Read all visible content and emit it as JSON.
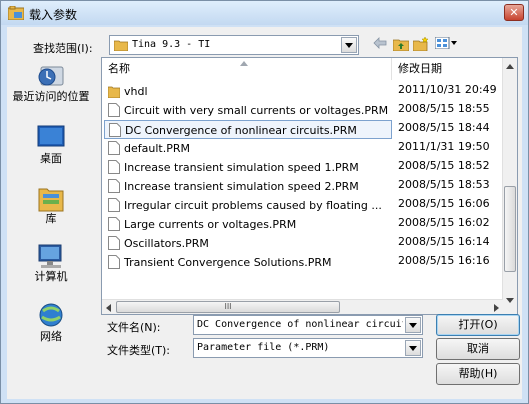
{
  "window": {
    "title": "载入参数",
    "close_label": "✕"
  },
  "toolbar": {
    "look_in_label": "查找范围(I):",
    "look_in_value": "Tina 9.3 - TI",
    "icons": [
      "back-arrow-icon",
      "up-folder-icon",
      "new-folder-icon",
      "view-menu-icon"
    ]
  },
  "places": [
    {
      "label": "最近访问的位置",
      "icon": "recent-places-icon"
    },
    {
      "label": "桌面",
      "icon": "desktop-icon"
    },
    {
      "label": "库",
      "icon": "libraries-icon"
    },
    {
      "label": "计算机",
      "icon": "computer-icon"
    },
    {
      "label": "网络",
      "icon": "network-icon"
    }
  ],
  "list": {
    "columns": [
      "名称",
      "修改日期"
    ],
    "rows": [
      {
        "name": "vhdl",
        "date": "2011/10/31 20:49",
        "type": "folder"
      },
      {
        "name": "Circuit with very small currents or voltages.PRM",
        "date": "2008/5/15 18:55",
        "type": "file"
      },
      {
        "name": "DC Convergence of nonlinear circuits.PRM",
        "date": "2008/5/15 18:44",
        "type": "file",
        "selected": true
      },
      {
        "name": "default.PRM",
        "date": "2011/1/31 19:50",
        "type": "file"
      },
      {
        "name": "Increase transient simulation speed 1.PRM",
        "date": "2008/5/15 18:52",
        "type": "file"
      },
      {
        "name": "Increase transient simulation speed 2.PRM",
        "date": "2008/5/15 18:53",
        "type": "file"
      },
      {
        "name": "Irregular circuit problems caused by floating ...",
        "date": "2008/5/15 16:06",
        "type": "file"
      },
      {
        "name": "Large currents or voltages.PRM",
        "date": "2008/5/15 16:02",
        "type": "file"
      },
      {
        "name": "Oscillators.PRM",
        "date": "2008/5/15 16:14",
        "type": "file"
      },
      {
        "name": "Transient Convergence Solutions.PRM",
        "date": "2008/5/15 16:16",
        "type": "file"
      }
    ],
    "hscroll_grip": "III"
  },
  "form": {
    "filename_label": "文件名(N):",
    "filename_value": "DC Convergence of nonlinear circuits",
    "filetype_label": "文件类型(T):",
    "filetype_value": "Parameter file (*.PRM)"
  },
  "buttons": {
    "open": "打开(O)",
    "cancel": "取消",
    "help": "帮助(H)"
  },
  "colors": {
    "title_bar": "#c3d9f1",
    "close": "#c7432f",
    "folder": "#e8b84a",
    "selection_border": "#7da2ce"
  }
}
